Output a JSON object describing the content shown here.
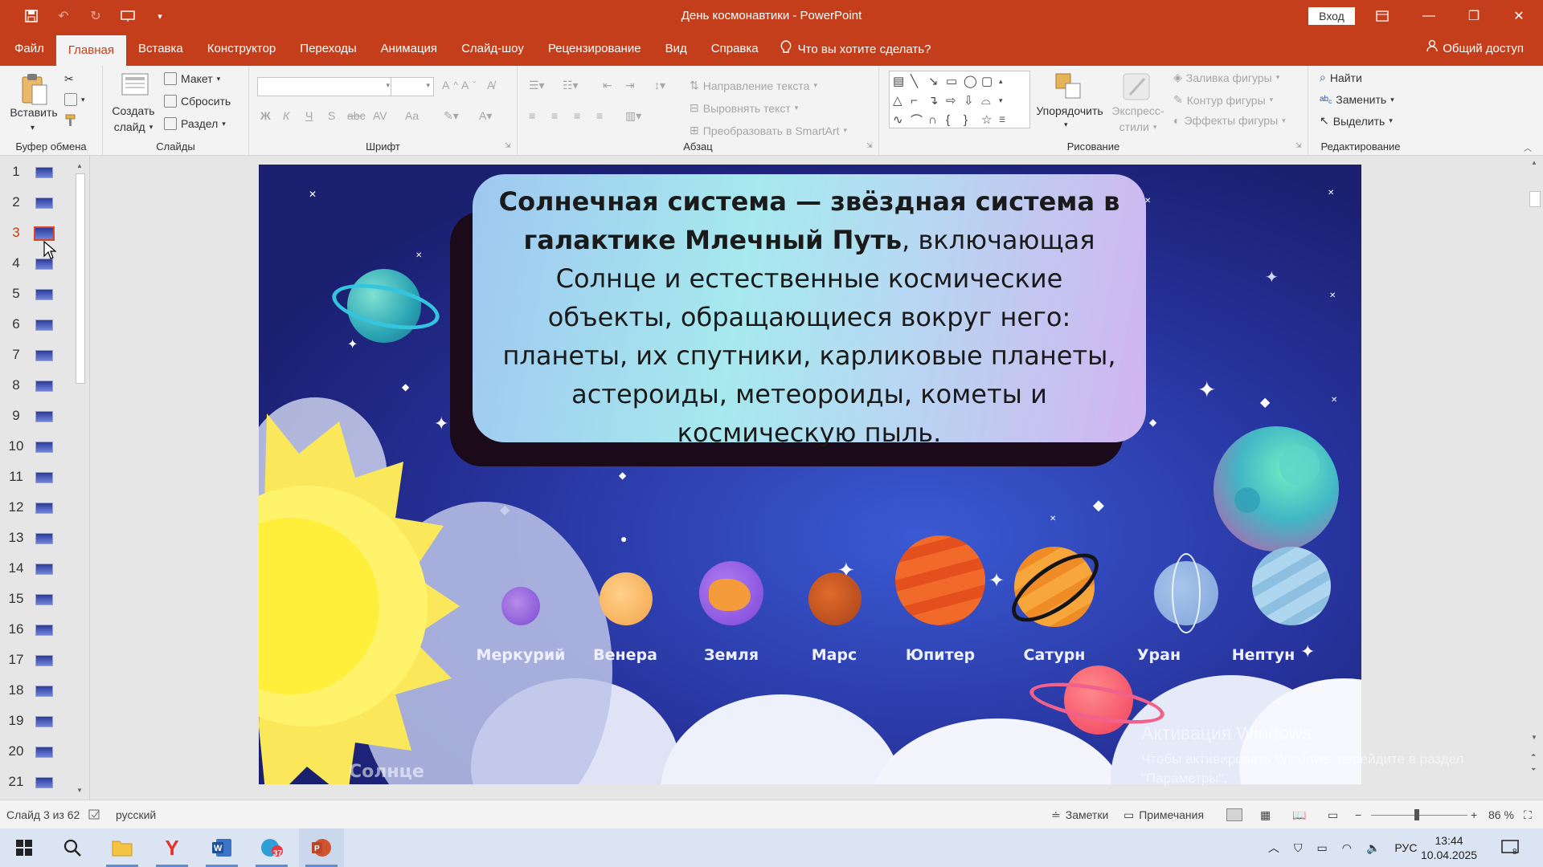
{
  "window": {
    "title": "День космонавтики - PowerPoint",
    "login_label": "Вход",
    "share_label": "Общий доступ"
  },
  "tabs": [
    "Файл",
    "Главная",
    "Вставка",
    "Конструктор",
    "Переходы",
    "Анимация",
    "Слайд-шоу",
    "Рецензирование",
    "Вид",
    "Справка"
  ],
  "active_tab": "Главная",
  "tell_me": "Что вы хотите сделать?",
  "ribbon": {
    "clipboard": {
      "label": "Буфер обмена",
      "paste": "Вставить"
    },
    "slides": {
      "label": "Слайды",
      "new_slide_line1": "Создать",
      "new_slide_line2": "слайд",
      "layout": "Макет",
      "reset": "Сбросить",
      "section": "Раздел"
    },
    "font": {
      "label": "Шрифт",
      "bold": "Ж",
      "italic": "К",
      "underline": "Ч",
      "shadow": "S",
      "strike": "abc",
      "spacing": "AV",
      "case": "Aa"
    },
    "paragraph": {
      "label": "Абзац",
      "text_direction": "Направление текста",
      "align_text": "Выровнять текст",
      "smartart": "Преобразовать в SmartArt"
    },
    "drawing": {
      "label": "Рисование",
      "arrange": "Упорядочить",
      "quick_styles_line1": "Экспресс-",
      "quick_styles_line2": "стили",
      "shape_fill": "Заливка фигуры",
      "shape_outline": "Контур фигуры",
      "shape_effects": "Эффекты фигуры"
    },
    "editing": {
      "label": "Редактирование",
      "find": "Найти",
      "replace": "Заменить",
      "select": "Выделить"
    }
  },
  "thumbnails": {
    "numbers": [
      "1",
      "2",
      "3",
      "4",
      "5",
      "6",
      "7",
      "8",
      "9",
      "10",
      "11",
      "12",
      "13",
      "14",
      "15",
      "16",
      "17",
      "18",
      "19",
      "20",
      "21"
    ],
    "current": "3"
  },
  "slide": {
    "text_bold": "Солнечная система — звёздная система в галактике Млечный Путь",
    "text_rest": ", включающая Солнце и естественные космические объекты, обращающиеся вокруг него: планеты, их спутники, карликовые планеты, астероиды, метеороиды, кометы и космическую пыль.",
    "planets": [
      "Меркурий",
      "Венера",
      "Земля",
      "Марс",
      "Юпитер",
      "Сатурн",
      "Уран",
      "Нептун"
    ],
    "sun_label": "Солнце"
  },
  "activation": {
    "title": "Активация Windows",
    "line1": "Чтобы активировать Windows, перейдите в раздел",
    "line2": "\"Параметры\"."
  },
  "status": {
    "slide_of": "Слайд 3 из 62",
    "language": "русский",
    "notes": "Заметки",
    "comments": "Примечания",
    "zoom": "86 %"
  },
  "taskbar": {
    "lang": "РУС",
    "time": "13:44",
    "date": "10.04.2025",
    "badge": "37",
    "notif": "8"
  },
  "colors": {
    "accent": "#c43e1c",
    "ribbon_bg": "#f3f3f3"
  }
}
